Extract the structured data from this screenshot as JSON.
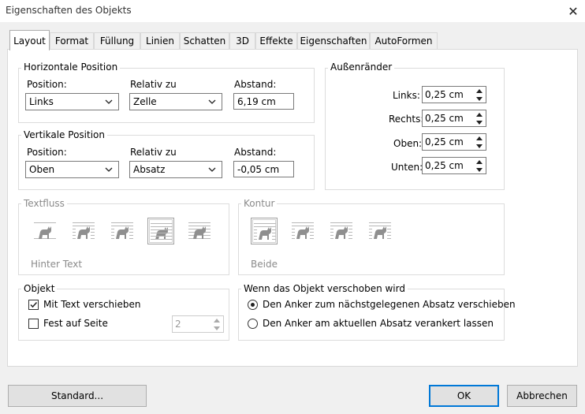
{
  "window": {
    "title": "Eigenschaften des Objekts",
    "close_glyph": "✕"
  },
  "tabs": [
    {
      "label": "Layout"
    },
    {
      "label": "Format"
    },
    {
      "label": "Füllung"
    },
    {
      "label": "Linien"
    },
    {
      "label": "Schatten"
    },
    {
      "label": "3D"
    },
    {
      "label": "Effekte"
    },
    {
      "label": "Eigenschaften"
    },
    {
      "label": "AutoFormen"
    }
  ],
  "horizontal": {
    "title": "Horizontale Position",
    "position_label": "Position:",
    "position_value": "Links",
    "relative_label": "Relativ zu",
    "relative_value": "Zelle",
    "distance_label": "Abstand:",
    "distance_value": "6,19 cm"
  },
  "vertical": {
    "title": "Vertikale Position",
    "position_label": "Position:",
    "position_value": "Oben",
    "relative_label": "Relativ zu",
    "relative_value": "Absatz",
    "distance_label": "Abstand:",
    "distance_value": "-0,05 cm"
  },
  "margins": {
    "title": "Außenränder",
    "left_label": "Links:",
    "left_value": "0,25 cm",
    "right_label": "Rechts:",
    "right_value": "0,25 cm",
    "top_label": "Oben:",
    "top_value": "0,25 cm",
    "bottom_label": "Unten:",
    "bottom_value": "0,25 cm"
  },
  "textflow": {
    "title": "Textfluss",
    "caption": "Hinter Text"
  },
  "contour": {
    "title": "Kontur",
    "caption": "Beide"
  },
  "object": {
    "title": "Objekt",
    "move_with_text_label": "Mit Text verschieben",
    "move_with_text_checked": true,
    "fixed_on_page_label": "Fest auf Seite",
    "fixed_on_page_checked": false,
    "page_value": "2"
  },
  "moving": {
    "title": "Wenn das Objekt verschoben wird",
    "option1": "Den Anker zum nächstgelegenen Absatz verschieben",
    "option2": "Den Anker am aktuellen Absatz verankert lassen",
    "selected": 1
  },
  "buttons": {
    "standard": "Standard...",
    "ok": "OK",
    "cancel": "Abbrechen"
  },
  "colors": {
    "accent": "#0078d7",
    "disabled_text": "#8a8a8a",
    "icon_gray": "#a8a8a8"
  }
}
